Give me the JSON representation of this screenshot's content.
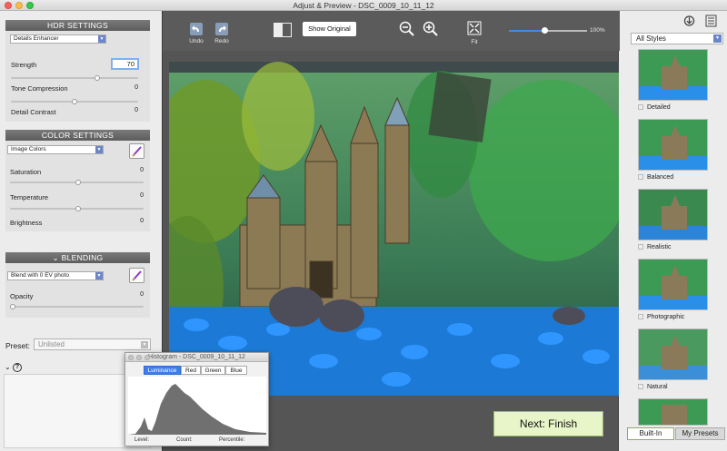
{
  "window": {
    "title": "Adjust & Preview - DSC_0009_10_11_12"
  },
  "hdr": {
    "header": "HDR SETTINGS",
    "method": "Details Enhancer",
    "strength_label": "Strength",
    "strength_value": "70",
    "tone_label": "Tone Compression",
    "tone_value": "0",
    "detail_label": "Detail Contrast",
    "detail_value": "0"
  },
  "color": {
    "header": "COLOR SETTINGS",
    "mode": "Image Colors",
    "saturation_label": "Saturation",
    "saturation_value": "0",
    "temperature_label": "Temperature",
    "temperature_value": "0",
    "brightness_label": "Brightness",
    "brightness_value": "0"
  },
  "blending": {
    "header": "BLENDING",
    "mode": "Blend with  0 EV photo",
    "opacity_label": "Opacity",
    "opacity_value": "0"
  },
  "preset": {
    "label": "Preset:",
    "value": "Unlisted"
  },
  "toolbar": {
    "undo": "Undo",
    "redo": "Redo",
    "show_original": "Show Original",
    "fit": "Fit",
    "zoom_value": "100%",
    "zoom_fraction": 0.45
  },
  "next_button": "Next: Finish",
  "styles": {
    "filter": "All Styles",
    "items": [
      "Detailed",
      "Balanced",
      "Realistic",
      "Photographic",
      "Natural"
    ],
    "tabs": [
      "Built-In",
      "My Presets"
    ]
  },
  "histogram": {
    "title": "Histogram - DSC_0009_10_11_12",
    "tabs": [
      "Luminance",
      "Red",
      "Green",
      "Blue"
    ],
    "level_label": "Level:",
    "count_label": "Count:",
    "percentile_label": "Percentile:"
  },
  "colors": {
    "accent": "#6b85c9",
    "next_bg": "#e8f5c8",
    "tab_active": "#3d7fe6"
  }
}
